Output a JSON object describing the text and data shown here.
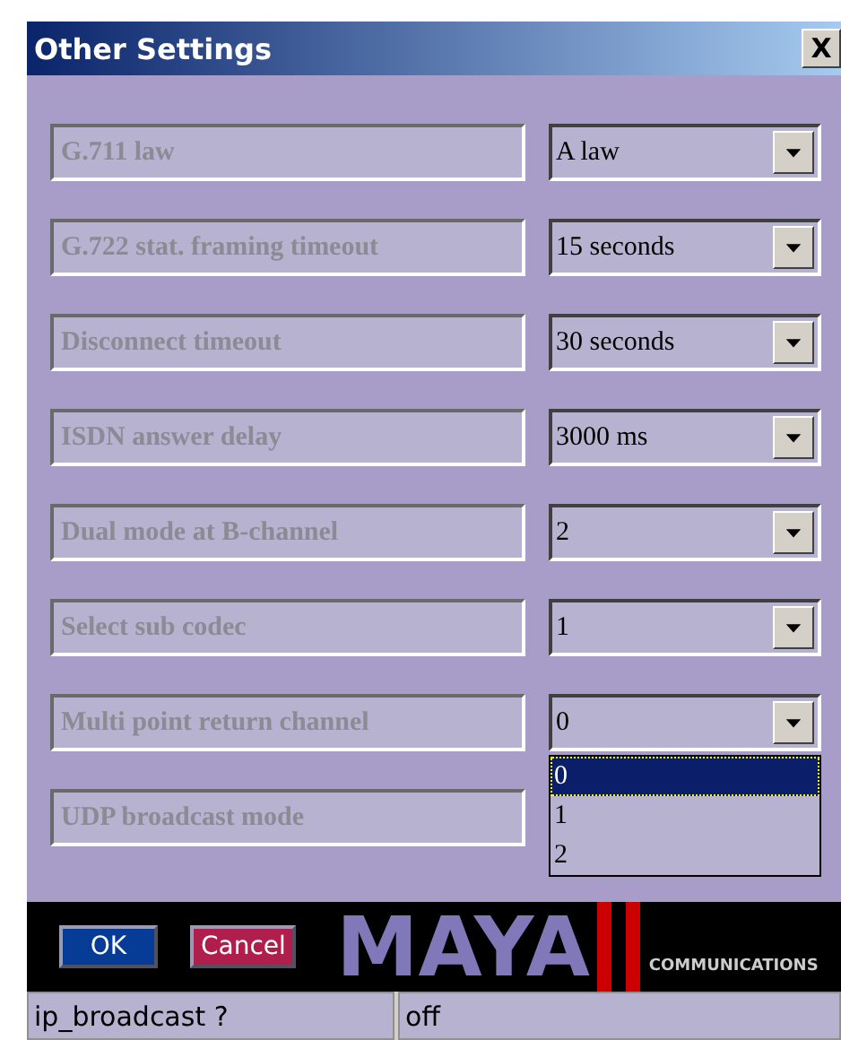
{
  "window": {
    "title": "Other Settings",
    "close": "X"
  },
  "settings": [
    {
      "label": "G.711 law",
      "value": "A law"
    },
    {
      "label": "G.722 stat. framing timeout",
      "value": "15 seconds"
    },
    {
      "label": "Disconnect timeout",
      "value": "30 seconds"
    },
    {
      "label": "ISDN answer delay",
      "value": "3000 ms"
    },
    {
      "label": "Dual mode at B-channel",
      "value": "2"
    },
    {
      "label": "Select sub codec",
      "value": "1"
    },
    {
      "label": "Multi point return channel",
      "value": "0",
      "expanded": true,
      "options": [
        {
          "label": "0",
          "selected": true
        },
        {
          "label": "1",
          "selected": false
        },
        {
          "label": "2",
          "selected": false
        }
      ]
    },
    {
      "label": "UDP broadcast mode"
    }
  ],
  "buttons": [
    {
      "label": "OK",
      "kind": "ok"
    },
    {
      "label": "Cancel",
      "kind": "cancel"
    }
  ],
  "logo": {
    "name": "MAYA",
    "tagline": "COMMUNICATIONS"
  },
  "status_bar": [
    "ip_broadcast ?",
    "off"
  ]
}
